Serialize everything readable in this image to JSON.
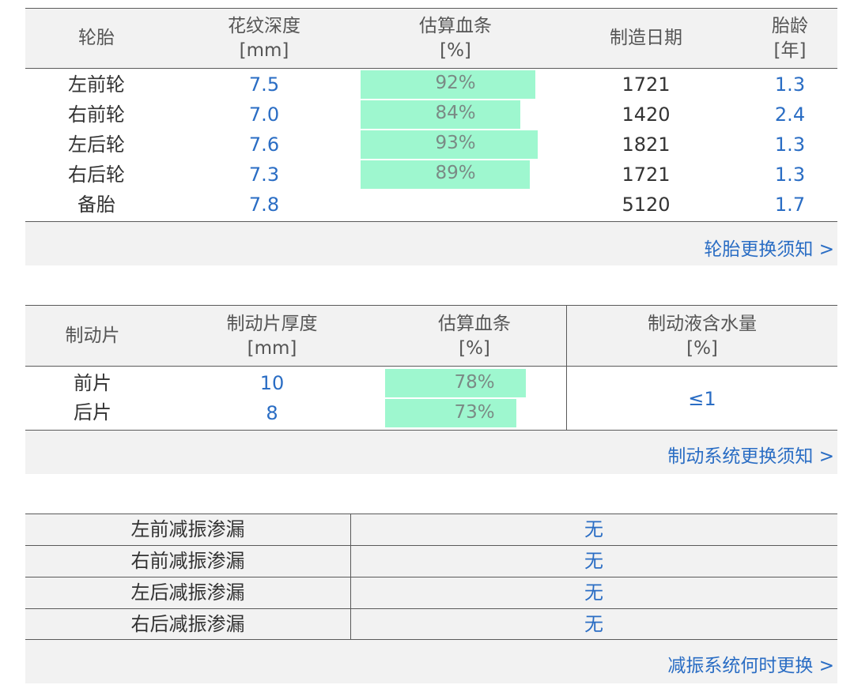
{
  "tires": {
    "headers": [
      {
        "line1": "轮胎",
        "line2": ""
      },
      {
        "line1": "花纹深度",
        "line2": "[mm]"
      },
      {
        "line1": "估算血条",
        "line2": "[%]"
      },
      {
        "line1": "制造日期",
        "line2": ""
      },
      {
        "line1": "胎龄",
        "line2": "[年]"
      }
    ],
    "rows": [
      {
        "name": "左前轮",
        "depth": "7.5",
        "health": "92%",
        "health_value": 0.92,
        "date": "1721",
        "age": "1.3"
      },
      {
        "name": "右前轮",
        "depth": "7.0",
        "health": "84%",
        "health_value": 0.84,
        "date": "1420",
        "age": "2.4"
      },
      {
        "name": "左后轮",
        "depth": "7.6",
        "health": "93%",
        "health_value": 0.93,
        "date": "1821",
        "age": "1.3"
      },
      {
        "name": "右后轮",
        "depth": "7.3",
        "health": "89%",
        "health_value": 0.89,
        "date": "1721",
        "age": "1.3"
      },
      {
        "name": "备胎",
        "depth": "7.8",
        "health": "",
        "health_value": null,
        "date": "5120",
        "age": "1.7"
      }
    ],
    "link": "轮胎更换须知 >"
  },
  "brakes": {
    "headers": [
      {
        "line1": "制动片",
        "line2": ""
      },
      {
        "line1": "制动片厚度",
        "line2": "[mm]"
      },
      {
        "line1": "估算血条",
        "line2": "[%]"
      },
      {
        "line1": "制动液含水量",
        "line2": "[%]"
      }
    ],
    "rows": [
      {
        "name": "前片",
        "thickness": "10",
        "health": "78%",
        "health_value": 0.78
      },
      {
        "name": "后片",
        "thickness": "8",
        "health": "73%",
        "health_value": 0.73
      }
    ],
    "fluid_water": "≤1",
    "link": "制动系统更换须知 >"
  },
  "shocks": {
    "rows": [
      {
        "label": "左前减振渗漏",
        "value": "无"
      },
      {
        "label": "右前减振渗漏",
        "value": "无"
      },
      {
        "label": "左后减振渗漏",
        "value": "无"
      },
      {
        "label": "右后减振渗漏",
        "value": "无"
      }
    ],
    "link": "减振系统何时更换 >"
  },
  "colors": {
    "accent_blue": "#2a6dc4",
    "bar_green": "#9ef7cf",
    "header_bg": "#f2f2f2"
  }
}
